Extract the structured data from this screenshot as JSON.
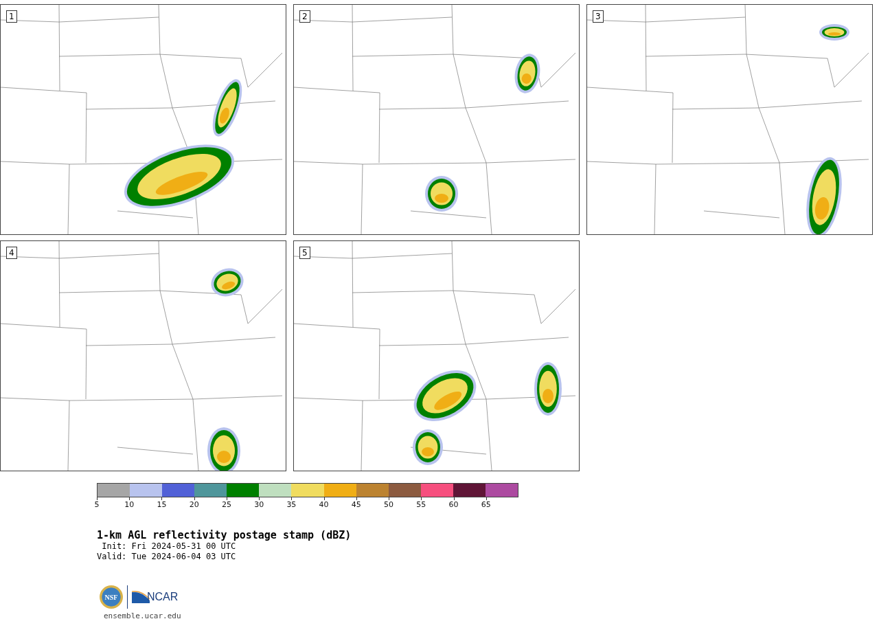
{
  "panels": [
    {
      "label": "1"
    },
    {
      "label": "2"
    },
    {
      "label": "3"
    },
    {
      "label": "4"
    },
    {
      "label": "5"
    }
  ],
  "colorbar": {
    "bins": [
      {
        "color": "#a6a6a6"
      },
      {
        "color": "#b8c3ee"
      },
      {
        "color": "#5161d7"
      },
      {
        "color": "#4f969b"
      },
      {
        "color": "#008000"
      },
      {
        "color": "#bfdfbf"
      },
      {
        "color": "#f0dc5f"
      },
      {
        "color": "#f0ae15"
      },
      {
        "color": "#bc8331"
      },
      {
        "color": "#8c5b40"
      },
      {
        "color": "#f64f7e"
      },
      {
        "color": "#5f1536"
      },
      {
        "color": "#ac4aa0"
      }
    ],
    "ticks": [
      "5",
      "10",
      "15",
      "20",
      "25",
      "30",
      "35",
      "40",
      "45",
      "50",
      "55",
      "60",
      "65"
    ]
  },
  "title": "1-km AGL reflectivity postage stamp (dBZ)",
  "init": " Init: Fri 2024-05-31 00 UTC",
  "valid": "Valid: Tue 2024-06-04 03 UTC",
  "logos": {
    "nsf": "NSF",
    "ncar": "NCAR"
  },
  "url": "ensemble.ucar.edu"
}
